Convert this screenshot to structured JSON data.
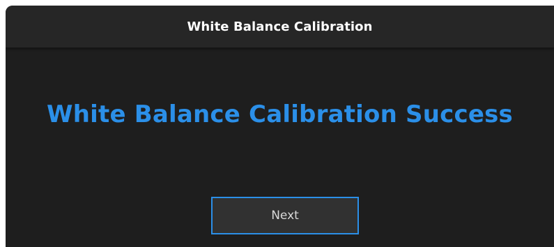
{
  "dialog": {
    "title": "White Balance Calibration",
    "message": "White Balance Calibration Success",
    "next_label": "Next"
  },
  "colors": {
    "accent": "#2b8fe8",
    "background": "#1e1e1e",
    "titlebar": "#262626",
    "button_bg": "#313131"
  }
}
